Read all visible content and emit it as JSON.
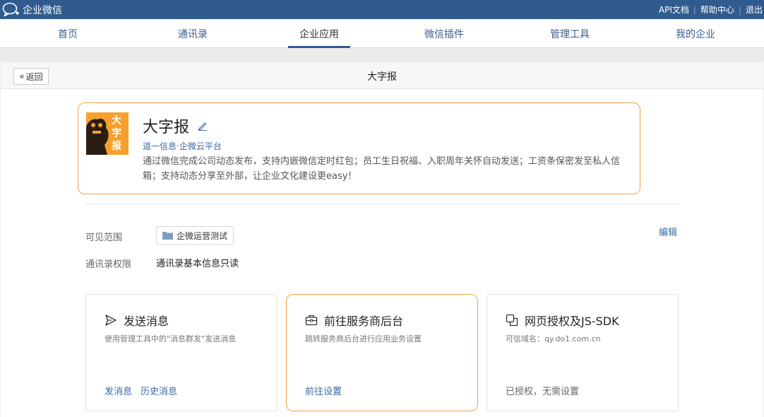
{
  "topbar": {
    "brand": "企业微信",
    "links": [
      "API文档",
      "帮助中心",
      "退出"
    ]
  },
  "nav": {
    "items": [
      "首页",
      "通讯录",
      "企业应用",
      "微信插件",
      "管理工具",
      "我的企业"
    ],
    "active": "企业应用"
  },
  "header": {
    "back_label": "返回",
    "title": "大字报"
  },
  "app": {
    "icon_text": "大字报",
    "name": "大字报",
    "vendor": "道一信息·企微云平台",
    "description": "通过微信完成公司动态发布，支持内嵌微信定时红包；员工生日祝福、入职周年关怀自动发送；工资条保密发至私人信箱；支持动态分享至外部，让企业文化建设更easy！"
  },
  "settings": {
    "scope_label": "可见范围",
    "scope_value": "企微运营测试",
    "edit_label": "编辑",
    "perm_label": "通讯录权限",
    "perm_value": "通讯录基本信息只读"
  },
  "cards": [
    {
      "title": "发送消息",
      "desc": "使用管理工具中的\"消息群发\"发送消息",
      "links": [
        "发消息",
        "历史消息"
      ],
      "plain": ""
    },
    {
      "title": "前往服务商后台",
      "desc": "跳转服务商后台进行应用业务设置",
      "links": [
        "前往设置"
      ],
      "plain": ""
    },
    {
      "title": "网页授权及JS-SDK",
      "desc": "可信域名：qy.do1.com.cn",
      "links": [],
      "plain": "已授权，无需设置"
    }
  ],
  "colors": {
    "topbar": "#2f5b8e",
    "link": "#3a69a3",
    "highlight_border": "#f0a449",
    "app_icon_bg": "#f6a02d"
  }
}
